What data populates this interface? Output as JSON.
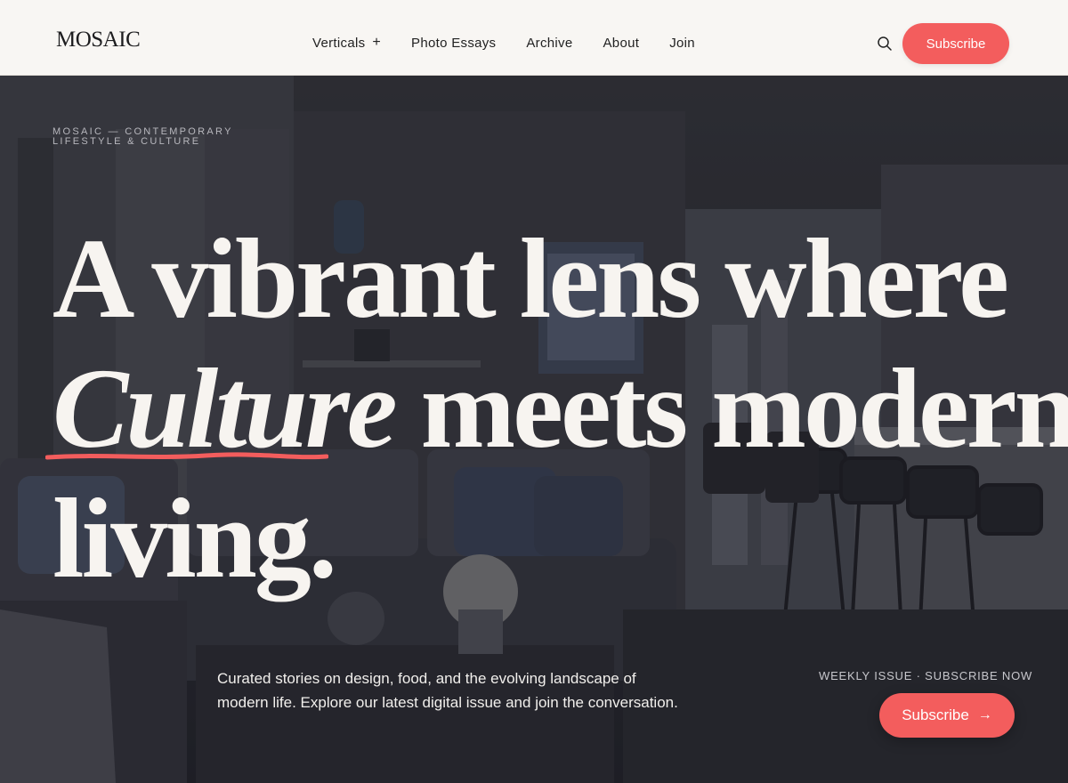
{
  "brand": {
    "logo": "MOSAIC"
  },
  "nav": {
    "items": [
      {
        "label": "Verticals",
        "plus": "+"
      },
      {
        "label": "Photo Essays"
      },
      {
        "label": "Archive"
      },
      {
        "label": "About"
      },
      {
        "label": "Join"
      }
    ]
  },
  "header": {
    "search_icon": "search-icon",
    "subscribe_label": "Subscribe"
  },
  "hero": {
    "kicker_line1": "MOSAIC — CONTEMPORARY",
    "kicker_line2": "LIFESTYLE & CULTURE",
    "headline_line1": "A vibrant lens where",
    "headline_italic": "Culture",
    "headline_line2_rest": " meets modern",
    "headline_line3": "living.",
    "intro": "Curated stories on design, food, and the evolving landscape of modern life. Explore our latest digital issue and join the conversation.",
    "weekly_label": "WEEKLY ISSUE · SUBSCRIBE NOW",
    "subscribe_label": "Subscribe",
    "subscribe_arrow": "→"
  },
  "colors": {
    "accent": "#f35d5d",
    "header_bg": "#f8f6f3",
    "hero_text": "#f7f4f0"
  }
}
